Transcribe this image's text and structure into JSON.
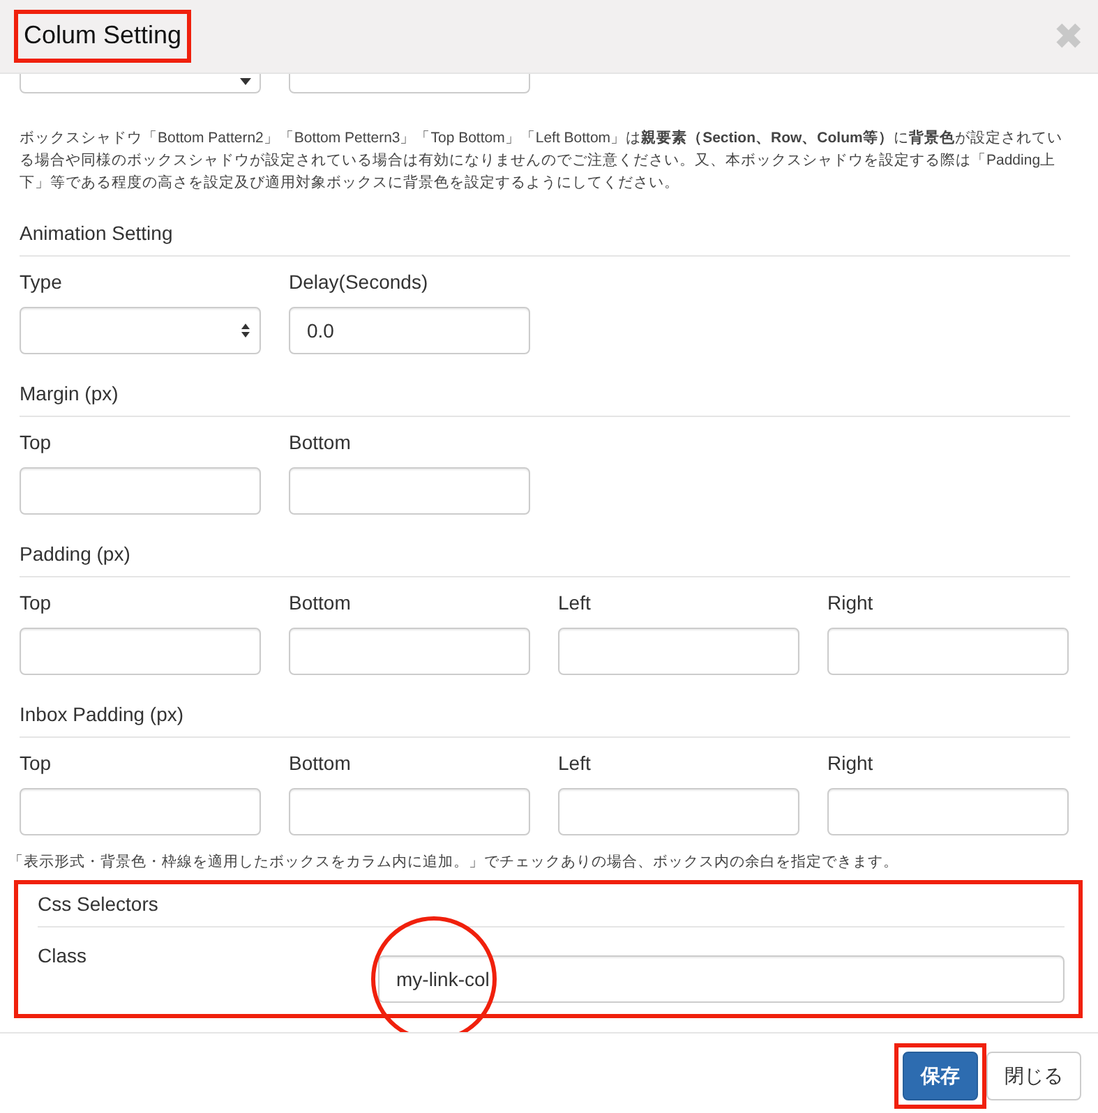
{
  "dialog": {
    "title": "Colum Setting",
    "title_highlighted": true,
    "close": "✖"
  },
  "cut_fields": [
    {
      "kind": "select"
    },
    {
      "kind": "text"
    }
  ],
  "note": "ボックスシャドウ「Bottom Pattern2」「Bottom Pettern3」「Top Bottom」「Left Bottom」は**親要素（Section、Row、Colum等）**に**背景色**が設定されている場合や同様のボックスシャドウが設定されている場合は有効になりませんのでご注意ください。又、本ボックスシャドウを設定する際は「Padding上下」等である程度の高さを設定及び適用対象ボックスに背景色を設定するようにしてください。",
  "sections": [
    {
      "title": "Animation Setting",
      "fields": [
        {
          "label": "Type",
          "kind": "select"
        },
        {
          "label": "Delay(Seconds)",
          "kind": "text",
          "value": "0.0"
        }
      ]
    },
    {
      "title": "Margin (px)",
      "fields": [
        {
          "label": "Top",
          "kind": "text"
        },
        {
          "label": "Bottom",
          "kind": "text"
        }
      ]
    },
    {
      "title": "Padding (px)",
      "fields": [
        {
          "label": "Top",
          "kind": "text"
        },
        {
          "label": "Bottom",
          "kind": "text"
        },
        {
          "label": "Left",
          "kind": "text"
        },
        {
          "label": "Right",
          "kind": "text"
        }
      ]
    },
    {
      "title": "Inbox Padding (px)",
      "fields": [
        {
          "label": "Top",
          "kind": "text"
        },
        {
          "label": "Bottom",
          "kind": "text"
        },
        {
          "label": "Left",
          "kind": "text"
        },
        {
          "label": "Right",
          "kind": "text"
        }
      ],
      "note": "「表示形式・背景色・枠線を適用したボックスをカラム内に追加。」でチェックありの場合、ボックス内の余白を指定できます。"
    }
  ],
  "css_section": {
    "title": "Css Selectors",
    "highlighted": true,
    "field": {
      "label": "Class",
      "value": "my-link-col",
      "circled": true
    }
  },
  "buttons": [
    {
      "label": "保存",
      "kind": "primary",
      "highlighted": true
    },
    {
      "label": "閉じる",
      "kind": "default",
      "highlighted": false
    }
  ]
}
